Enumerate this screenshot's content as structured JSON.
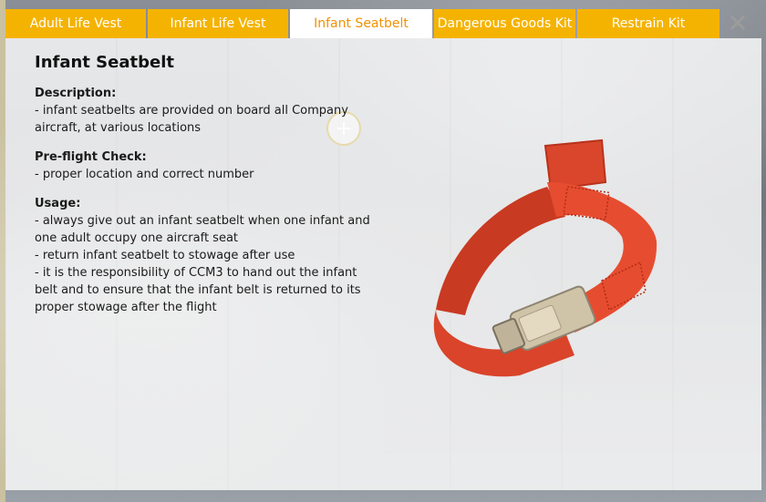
{
  "tabs": [
    {
      "label": "Adult Life Vest"
    },
    {
      "label": "Infant Life Vest"
    },
    {
      "label": "Infant Seatbelt"
    },
    {
      "label": "Dangerous Goods Kit"
    },
    {
      "label": "Restrain Kit"
    }
  ],
  "active_tab": "Infant Seatbelt",
  "close": {
    "glyph": "✕"
  },
  "panel": {
    "title": "Infant Seatbelt",
    "description": {
      "heading": "Description:",
      "lines": [
        "- infant seatbelts are provided on board all Company",
        "aircraft, at various locations"
      ]
    },
    "preflight": {
      "heading": "Pre-flight Check:",
      "lines": [
        "- proper location and correct number"
      ]
    },
    "usage": {
      "heading": "Usage:",
      "lines": [
        "- always give out an infant seatbelt when one infant and",
        "one adult occupy one aircraft seat",
        "- return infant seatbelt to stowage after use",
        "- it is the responsibility of CCM3 to hand out the infant",
        "belt and to ensure that the infant belt is returned to its",
        "proper stowage after the flight"
      ]
    }
  },
  "hotspot": {
    "glyph": "+"
  },
  "colors": {
    "tab_bg": "#f5b301",
    "tab_active_text": "#f29100",
    "belt": "#e0432a"
  }
}
